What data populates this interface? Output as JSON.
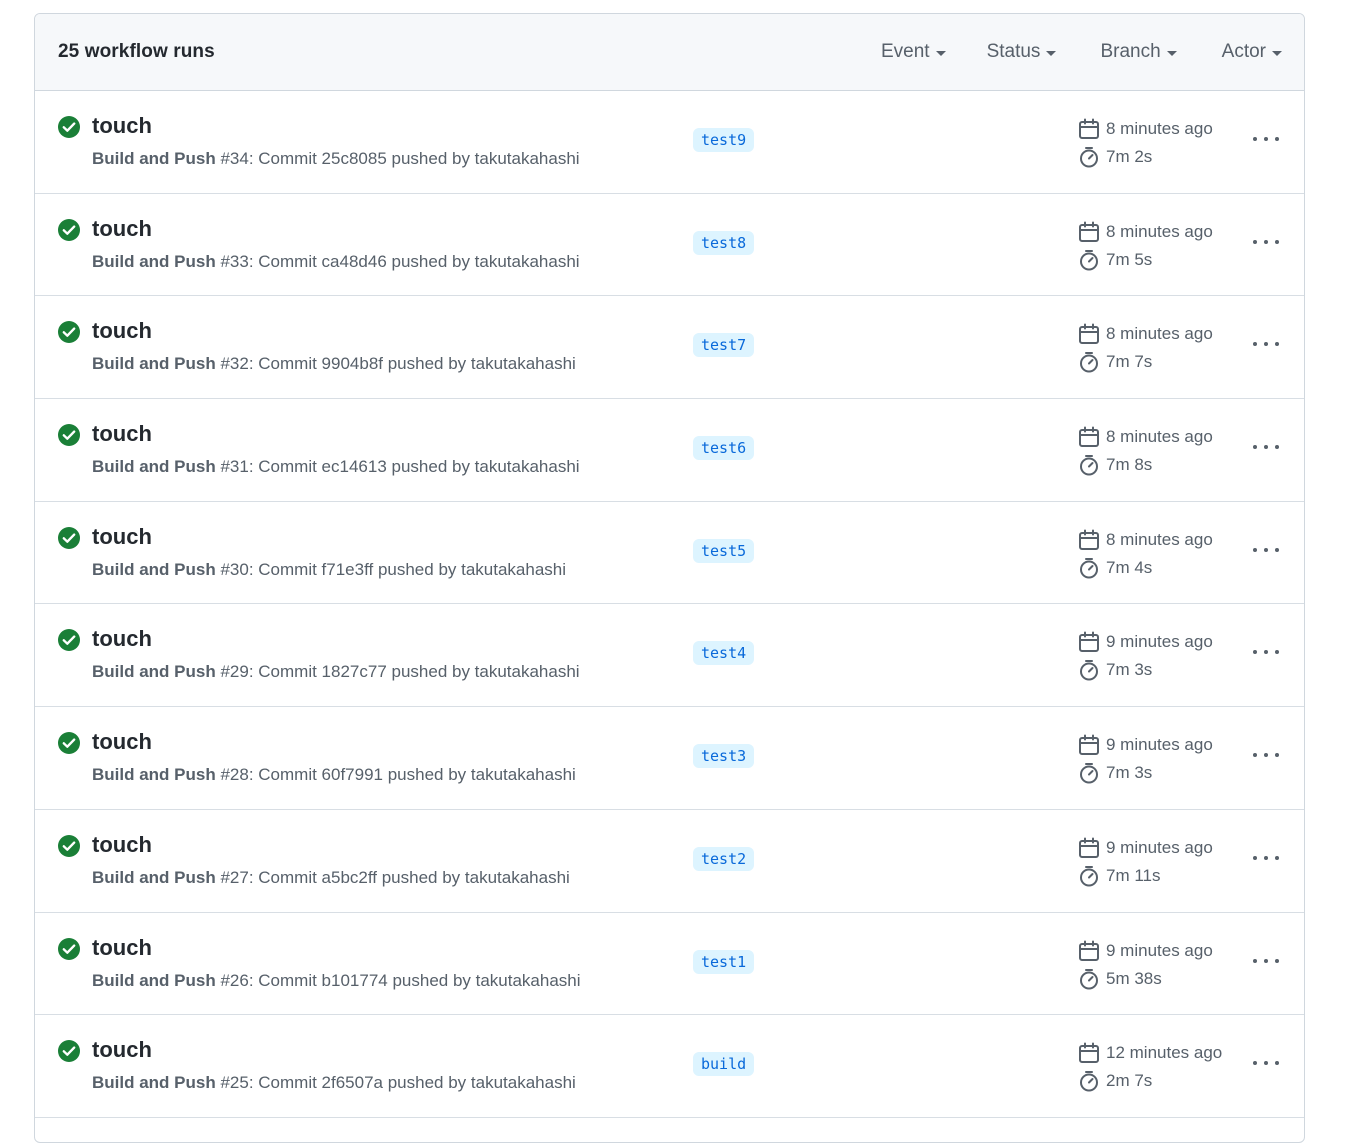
{
  "header": {
    "runs_count": "25 workflow runs",
    "filters": {
      "event": "Event",
      "status": "Status",
      "branch": "Branch",
      "actor": "Actor"
    }
  },
  "colors": {
    "success": "#1a7f37",
    "branch_bg": "#ddf4ff",
    "branch_text": "#0969da"
  },
  "runs": [
    {
      "title": "touch",
      "workflow": "Build and Push",
      "detail": " #34: Commit 25c8085 pushed by takutakahashi",
      "branch": "test9",
      "when": "8 minutes ago",
      "duration": "7m 2s"
    },
    {
      "title": "touch",
      "workflow": "Build and Push",
      "detail": " #33: Commit ca48d46 pushed by takutakahashi",
      "branch": "test8",
      "when": "8 minutes ago",
      "duration": "7m 5s"
    },
    {
      "title": "touch",
      "workflow": "Build and Push",
      "detail": " #32: Commit 9904b8f pushed by takutakahashi",
      "branch": "test7",
      "when": "8 minutes ago",
      "duration": "7m 7s"
    },
    {
      "title": "touch",
      "workflow": "Build and Push",
      "detail": " #31: Commit ec14613 pushed by takutakahashi",
      "branch": "test6",
      "when": "8 minutes ago",
      "duration": "7m 8s"
    },
    {
      "title": "touch",
      "workflow": "Build and Push",
      "detail": " #30: Commit f71e3ff pushed by takutakahashi",
      "branch": "test5",
      "when": "8 minutes ago",
      "duration": "7m 4s"
    },
    {
      "title": "touch",
      "workflow": "Build and Push",
      "detail": " #29: Commit 1827c77 pushed by takutakahashi",
      "branch": "test4",
      "when": "9 minutes ago",
      "duration": "7m 3s"
    },
    {
      "title": "touch",
      "workflow": "Build and Push",
      "detail": " #28: Commit 60f7991 pushed by takutakahashi",
      "branch": "test3",
      "when": "9 minutes ago",
      "duration": "7m 3s"
    },
    {
      "title": "touch",
      "workflow": "Build and Push",
      "detail": " #27: Commit a5bc2ff pushed by takutakahashi",
      "branch": "test2",
      "when": "9 minutes ago",
      "duration": "7m 11s"
    },
    {
      "title": "touch",
      "workflow": "Build and Push",
      "detail": " #26: Commit b101774 pushed by takutakahashi",
      "branch": "test1",
      "when": "9 minutes ago",
      "duration": "5m 38s"
    },
    {
      "title": "touch",
      "workflow": "Build and Push",
      "detail": " #25: Commit 2f6507a pushed by takutakahashi",
      "branch": "build",
      "when": "12 minutes ago",
      "duration": "2m 7s"
    }
  ]
}
